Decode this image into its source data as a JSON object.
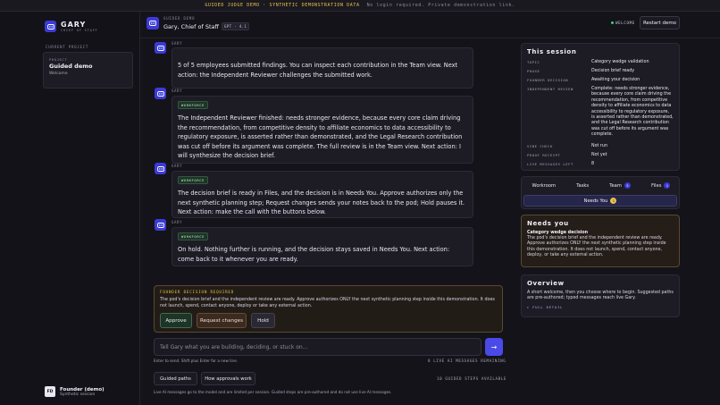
{
  "banner": {
    "highlight": "GUIDED JUDGE DEMO · SYNTHETIC DEMONSTRATION DATA",
    "note": "No login required. Private demonstration link."
  },
  "sidebar": {
    "brand_name": "GARY",
    "brand_sub": "CHIEF OF STAFF",
    "section_label": "CURRENT PROJECT",
    "project": {
      "label": "PROJECT",
      "title": "Guided demo",
      "sub": "Welcome"
    },
    "user": {
      "initials": "FD",
      "name": "Founder (demo)",
      "sub": "Synthetic session"
    }
  },
  "topbar": {
    "kicker": "GUIDED DEMO",
    "title": "Gary, Chief of Staff",
    "badge": "GPT · 4.1",
    "status": "WELCOME",
    "restart": "Restart demo"
  },
  "messages": [
    {
      "who": "GARY",
      "tag": "",
      "text": "5 of 5 employees submitted findings. You can inspect each contribution in the Team view. Next action: the Independent Reviewer challenges the submitted work."
    },
    {
      "who": "GARY",
      "tag": "WORKFORCE",
      "text": "The Independent Reviewer finished: needs stronger evidence, because every core claim driving the recommendation, from competitive density to affiliate economics to data accessibility to regulatory exposure, is asserted rather than demonstrated, and the Legal Research contribution was cut off before its argument was complete. The full review is in the Team view. Next action: I will synthesize the decision brief."
    },
    {
      "who": "GARY",
      "tag": "WORKFORCE",
      "text": "The decision brief is ready in Files, and the decision is in Needs You. Approve authorizes only the next synthetic planning step; Request changes sends your notes back to the pod; Hold pauses it. Next action: make the call with the buttons below."
    },
    {
      "who": "GARY",
      "tag": "WORKFORCE",
      "text": "On hold. Nothing further is running, and the decision stays saved in Needs You. Next action: come back to it whenever you are ready."
    }
  ],
  "decision": {
    "title": "FOUNDER DECISION REQUIRED",
    "text": "The pod's decision brief and the independent review are ready. Approve authorizes ONLY the next synthetic planning step inside this demonstration. It does not launch, spend, contact anyone, deploy or take any external action.",
    "approve": "Approve",
    "changes": "Request changes",
    "hold": "Hold"
  },
  "composer": {
    "placeholder": "Tell Gary what you are building, deciding, or stuck on...",
    "send": "→",
    "hint": "Enter to send. Shift plus Enter for a new line.",
    "remaining": "8 LIVE AI MESSAGES REMAINING",
    "guided_paths": "Guided paths",
    "how_approvals": "How approvals work",
    "steps": "10 GUIDED STEPS AVAILABLE",
    "footnote": "Live AI messages go to the model and are limited per session. Guided steps are pre-authored and do not use live AI messages."
  },
  "session": {
    "title": "This session",
    "rows": [
      {
        "k": "TOPIC",
        "v": "Category wedge validation"
      },
      {
        "k": "PHASE",
        "v": "Decision brief ready"
      },
      {
        "k": "FOUNDER DECISION",
        "v": "Awaiting your decision"
      },
      {
        "k": "INDEPENDENT REVIEW",
        "v": "Complete: needs stronger evidence, because every core claim driving the recommendation, from competitive density to affiliate economics to data accessibility to regulatory exposure, is asserted rather than demonstrated, and the Legal Research contribution was cut off before its argument was complete."
      },
      {
        "k": "VIBE CHECK",
        "v": "Not run"
      },
      {
        "k": "PROOF RECEIPT",
        "v": "Not yet"
      },
      {
        "k": "LIVE MESSAGES LEFT",
        "v": "8"
      }
    ]
  },
  "tabs": {
    "items": [
      {
        "label": "Workroom",
        "count": ""
      },
      {
        "label": "Tasks",
        "count": ""
      },
      {
        "label": "Team",
        "count": "5"
      },
      {
        "label": "Files",
        "count": "1"
      }
    ],
    "needs_label": "Needs You",
    "needs_count": "1"
  },
  "needs_you": {
    "title": "Needs you",
    "item_title": "Category wedge decision",
    "item_text": "The pod's decision brief and the independent review are ready. Approve authorizes ONLY the next synthetic planning step inside this demonstration. It does not launch, spend, contact anyone, deploy, or take any external action."
  },
  "overview": {
    "title": "Overview",
    "text": "A short welcome, then you choose where to begin. Suggested paths are pre-authored; typed messages reach live Gary.",
    "link": "▸ FULL DETAIL"
  },
  "colors": {
    "accent": "#3b3bd8",
    "amber": "#e6c34a",
    "green": "#38d17a"
  }
}
